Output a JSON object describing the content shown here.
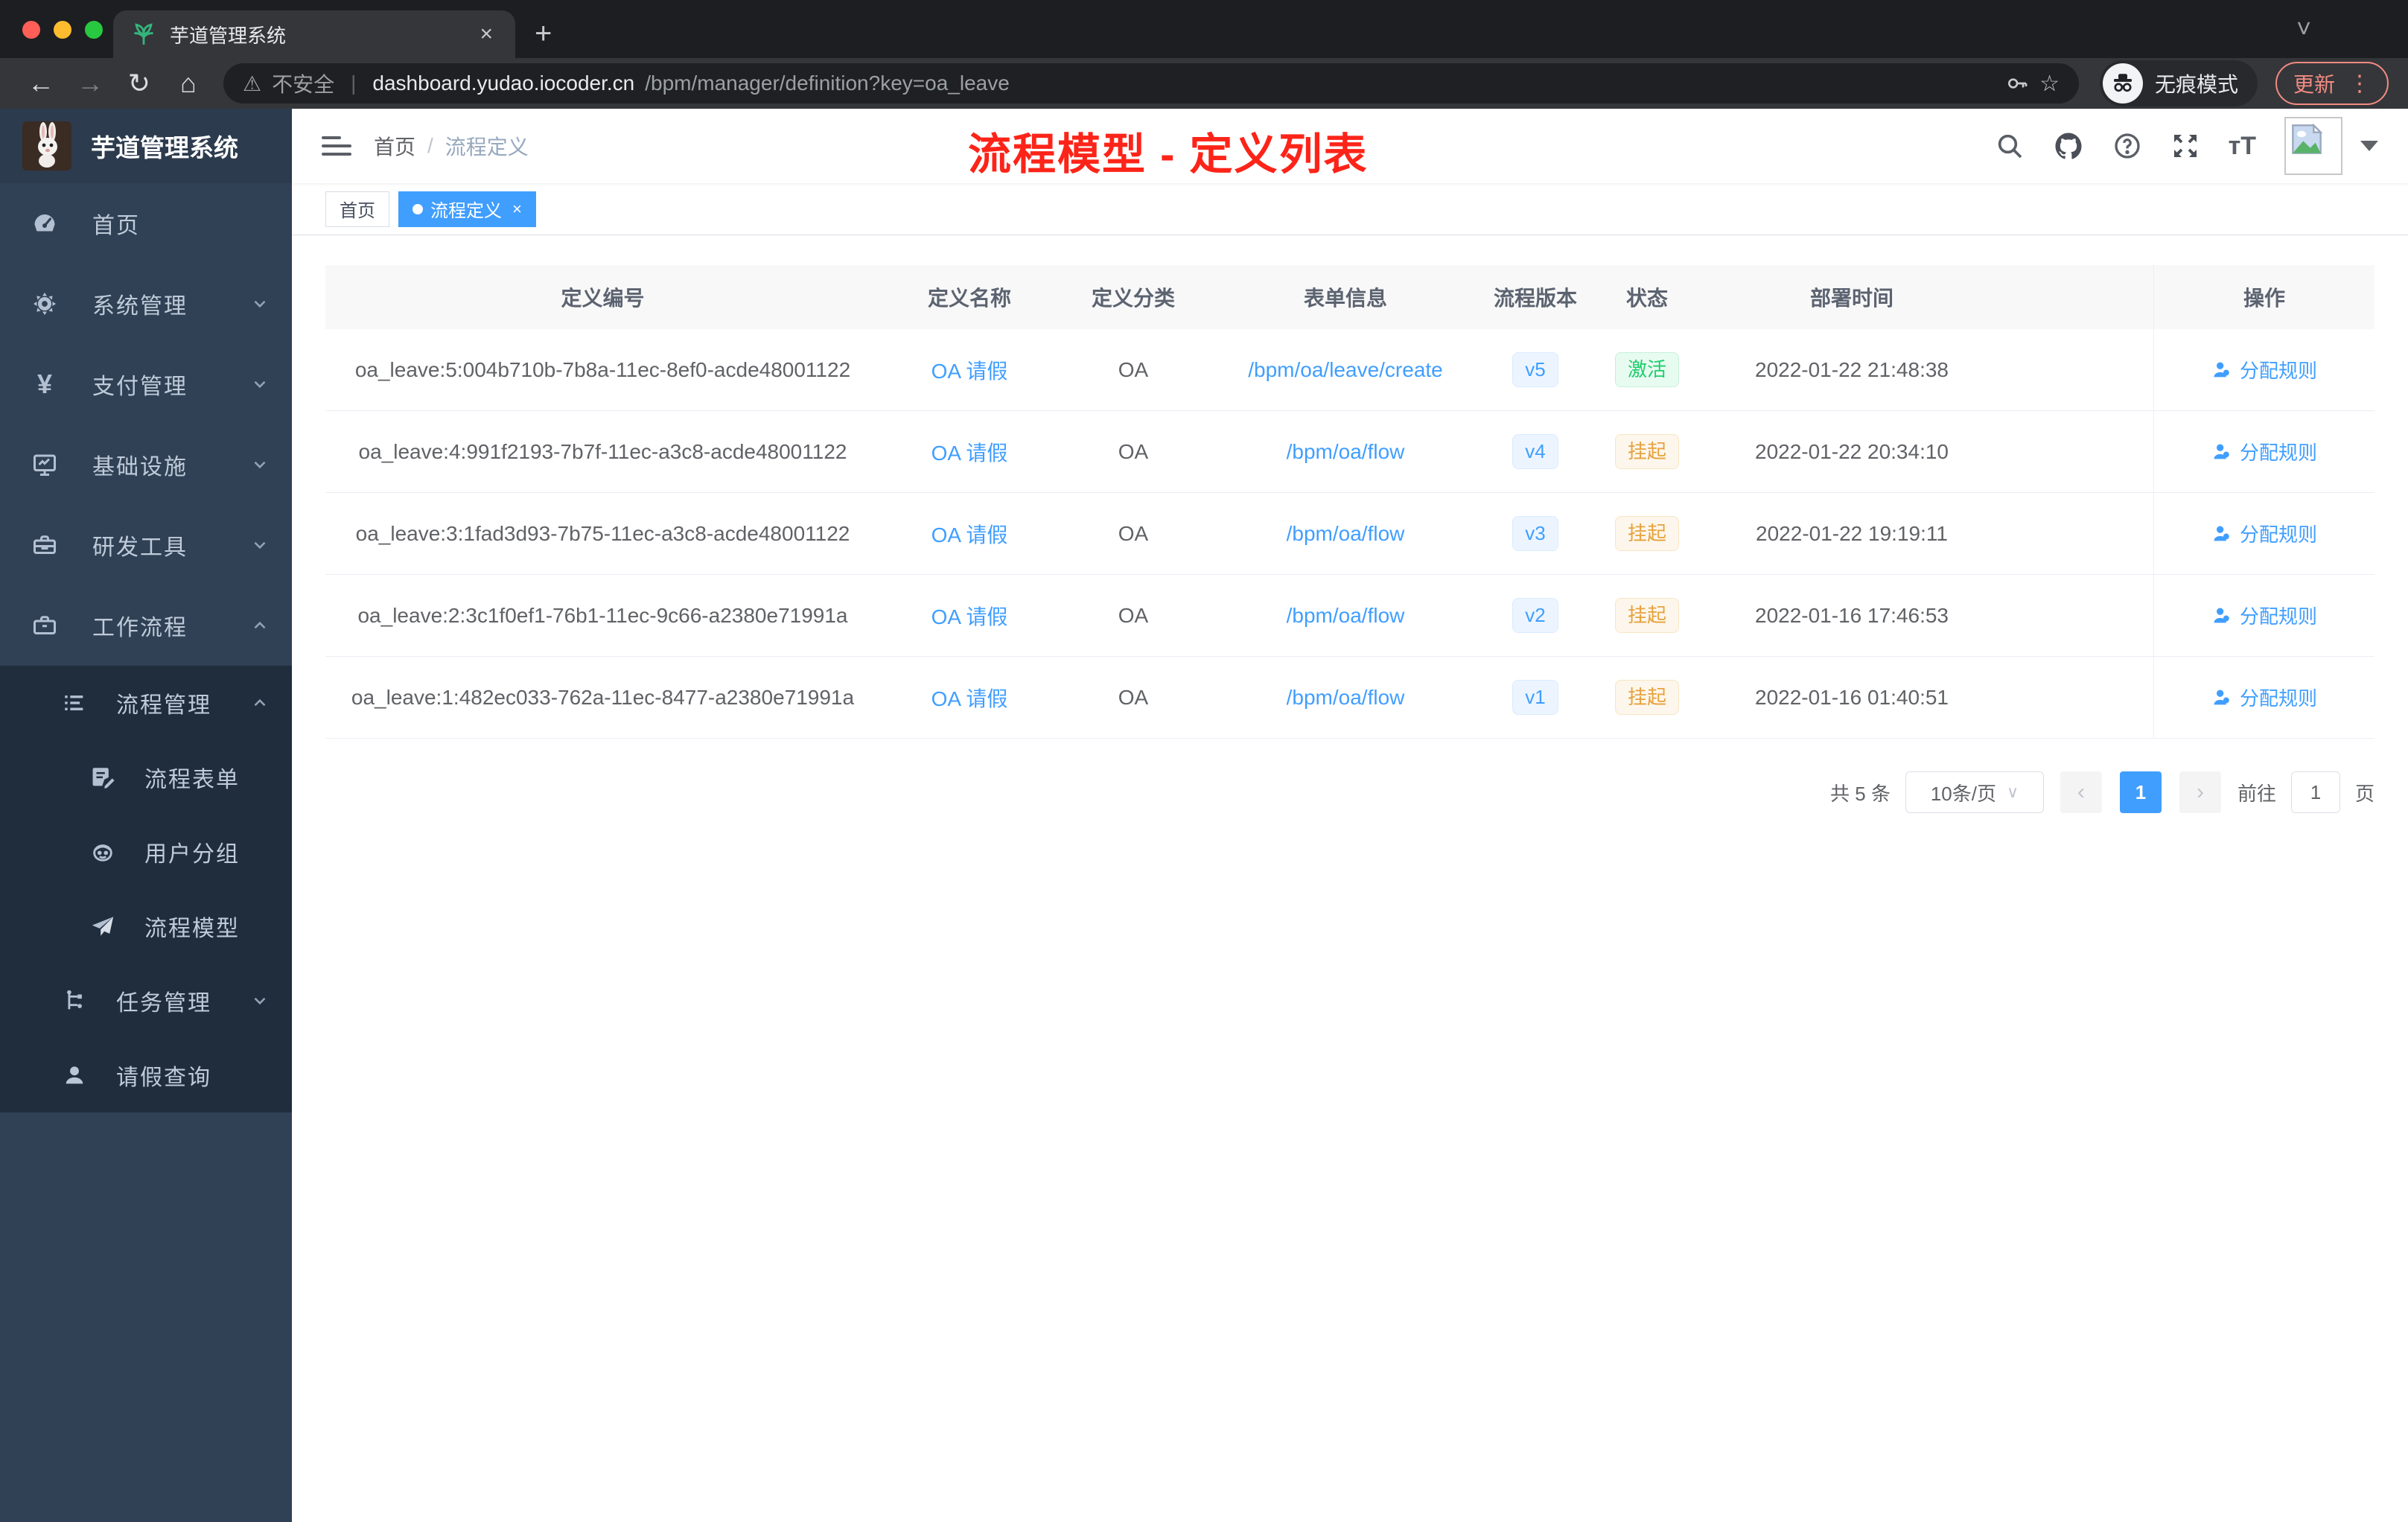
{
  "colors": {
    "accent": "#409eff",
    "sidebar_bg": "#304156",
    "submenu_bg": "#1f2d3d",
    "success": "#1dce6c",
    "warning": "#e6a23c",
    "annotation_red": "#fc2419",
    "chrome_update": "#f28b82",
    "tab_bg": "#35363a",
    "frame_bg": "#1d1e21"
  },
  "glyphs": {
    "close": "×",
    "plus": "+",
    "more": "⋮",
    "star": "☆",
    "back": "←",
    "forward": "→",
    "reload": "↻",
    "home": "⌂",
    "warning": "⚠",
    "url_sep": "|",
    "chevron_down": "∨",
    "tabsearch": "˅",
    "dot_sep": "/",
    "prev": "‹",
    "next": "›",
    "font_size": "тT"
  },
  "browser": {
    "tab_title": "芋道管理系统",
    "not_secure": "不安全",
    "url_host": "dashboard.yudao.iocoder.cn",
    "url_path": "/bpm/manager/definition?key=oa_leave",
    "incognito_label": "无痕模式",
    "update_label": "更新"
  },
  "sidebar": {
    "title": "芋道管理系统",
    "menu": {
      "home": "首页",
      "system": "系统管理",
      "pay": "支付管理",
      "infra": "基础设施",
      "dev": "研发工具",
      "workflow": "工作流程",
      "process_mgmt": "流程管理",
      "process_form": "流程表单",
      "user_group": "用户分组",
      "process_model": "流程模型",
      "task_mgmt": "任务管理",
      "leave_query": "请假查询"
    }
  },
  "header": {
    "breadcrumb_home": "首页",
    "breadcrumb_current": "流程定义",
    "annotation": "流程模型 - 定义列表"
  },
  "tags": {
    "home": "首页",
    "current": "流程定义"
  },
  "table": {
    "columns": {
      "id": "定义编号",
      "name": "定义名称",
      "category": "定义分类",
      "form": "表单信息",
      "version": "流程版本",
      "status": "状态",
      "deployed": "部署时间",
      "action": "操作"
    },
    "rows": [
      {
        "id": "oa_leave:5:004b710b-7b8a-11ec-8ef0-acde48001122",
        "name": "OA 请假",
        "category": "OA",
        "form": "/bpm/oa/leave/create",
        "version": "v5",
        "status": "激活",
        "status_type": "success",
        "deployed": "2022-01-22 21:48:38",
        "action": "分配规则"
      },
      {
        "id": "oa_leave:4:991f2193-7b7f-11ec-a3c8-acde48001122",
        "name": "OA 请假",
        "category": "OA",
        "form": "/bpm/oa/flow",
        "version": "v4",
        "status": "挂起",
        "status_type": "warning",
        "deployed": "2022-01-22 20:34:10",
        "action": "分配规则"
      },
      {
        "id": "oa_leave:3:1fad3d93-7b75-11ec-a3c8-acde48001122",
        "name": "OA 请假",
        "category": "OA",
        "form": "/bpm/oa/flow",
        "version": "v3",
        "status": "挂起",
        "status_type": "warning",
        "deployed": "2022-01-22 19:19:11",
        "action": "分配规则"
      },
      {
        "id": "oa_leave:2:3c1f0ef1-76b1-11ec-9c66-a2380e71991a",
        "name": "OA 请假",
        "category": "OA",
        "form": "/bpm/oa/flow",
        "version": "v2",
        "status": "挂起",
        "status_type": "warning",
        "deployed": "2022-01-16 17:46:53",
        "action": "分配规则"
      },
      {
        "id": "oa_leave:1:482ec033-762a-11ec-8477-a2380e71991a",
        "name": "OA 请假",
        "category": "OA",
        "form": "/bpm/oa/flow",
        "version": "v1",
        "status": "挂起",
        "status_type": "warning",
        "deployed": "2022-01-16 01:40:51",
        "action": "分配规则"
      }
    ]
  },
  "pagination": {
    "total": "共 5 条",
    "page_size": "10条/页",
    "page": "1",
    "goto": "前往",
    "unit": "页",
    "goto_value": "1"
  }
}
